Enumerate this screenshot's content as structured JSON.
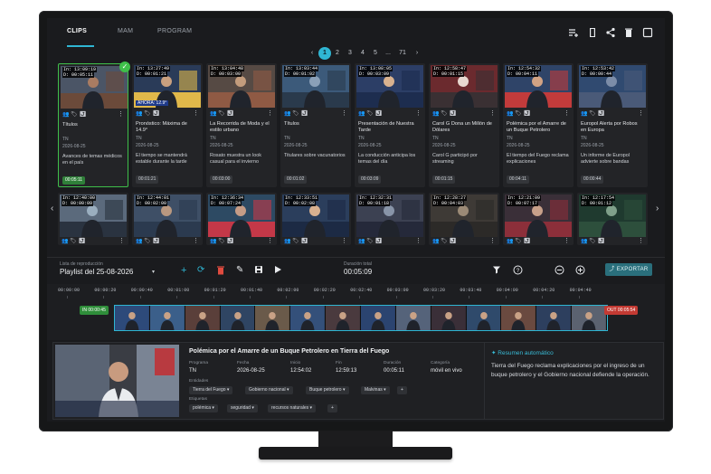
{
  "tabs": [
    {
      "label": "CLIPS",
      "active": true
    },
    {
      "label": "MAM",
      "active": false
    },
    {
      "label": "PROGRAM",
      "active": false
    }
  ],
  "top_icons": [
    "playlist-add-icon",
    "bookmark-icon",
    "share-icon",
    "delete-sweep-icon",
    "square-icon"
  ],
  "pagination": {
    "prev": "‹",
    "pages": [
      "1",
      "2",
      "3",
      "4",
      "5",
      "...",
      "71"
    ],
    "next": "›",
    "current": "1"
  },
  "clips_row1": [
    {
      "in": "In: 13:09:19",
      "dur": "D: 00:05:11",
      "title": "Títulos",
      "program": "TN",
      "date": "2026-08-25",
      "desc": "Avances de temas médicos en el país",
      "duration": "00:05:11",
      "selected": true
    },
    {
      "in": "In: 13:27:49",
      "dur": "D: 00:01:21",
      "title": "Pronóstico: Máxima de 14.9°",
      "program": "TN",
      "date": "2026-08-25",
      "desc": "El tiempo se mantendrá estable durante la tarde",
      "duration": "00:01:21",
      "overlay": "AHORA: 12.9°"
    },
    {
      "in": "In: 13:04:48",
      "dur": "D: 00:03:00",
      "title": "La Recorrida de Moda y el estilo urbano",
      "program": "TN",
      "date": "2026-08-25",
      "desc": "Rosato muestra un look casual para el invierno",
      "duration": "00:03:00"
    },
    {
      "in": "In: 13:03:44",
      "dur": "D: 00:01:02",
      "title": "Títulos",
      "program": "TN",
      "date": "2026-08-25",
      "desc": "Titulares sobre vacunatorios",
      "duration": "00:01:02"
    },
    {
      "in": "In: 13:08:05",
      "dur": "D: 00:03:09",
      "title": "Presentación de Nuestra Tarde",
      "program": "TN",
      "date": "2026-08-25",
      "desc": "La conducción anticipa los temas del día",
      "duration": "00:03:09"
    },
    {
      "in": "In: 12:58:47",
      "dur": "D: 00:01:15",
      "title": "Carol G Dona un Millón de Dólares",
      "program": "TN",
      "date": "2026-08-25",
      "desc": "Carol G participó por streaming",
      "duration": "00:01:15"
    },
    {
      "in": "In: 12:54:32",
      "dur": "D: 00:04:11",
      "title": "Polémica por el Amarre de un Buque Petrolero",
      "program": "TN",
      "date": "2026-08-25",
      "desc": "El tiempo del Fuego reclama explicaciones",
      "duration": "00:04:11"
    },
    {
      "in": "In: 12:53:42",
      "dur": "D: 00:00:44",
      "title": "Europol Alerta por Robos en Europa",
      "program": "TN",
      "date": "2026-08-25",
      "desc": "Un informe de Europol advierte sobre bandas",
      "duration": "00:00:44"
    }
  ],
  "clips_row2": [
    {
      "in": "In: 12:40:00",
      "dur": "D: 00:00:09"
    },
    {
      "in": "In: 12:44:01",
      "dur": "D: 00:02:00"
    },
    {
      "in": "In: 12:36:34",
      "dur": "D: 00:07:24"
    },
    {
      "in": "In: 12:33:51",
      "dur": "D: 00:02:08"
    },
    {
      "in": "In: 12:32:31",
      "dur": "D: 00:01:18"
    },
    {
      "in": "In: 12:28:27",
      "dur": "D: 00:04:03"
    },
    {
      "in": "In: 12:21:09",
      "dur": "D: 00:07:17"
    },
    {
      "in": "In: 12:17:54",
      "dur": "D: 00:01:12"
    }
  ],
  "toolbar": {
    "playlist_label": "Lista de reproducción",
    "playlist_value": "Playlist del 25-08-2026",
    "duration_label": "Duración total",
    "duration_value": "00:05:09",
    "export_label": "EXPORTAR"
  },
  "timeline": {
    "ticks": [
      "00:00:00",
      "00:00:20",
      "00:00:40",
      "00:01:00",
      "00:01:20",
      "00:01:40",
      "00:02:00",
      "00:02:20",
      "00:02:40",
      "00:03:00",
      "00:03:20",
      "00:03:40",
      "00:04:00",
      "00:04:20",
      "00:04:40"
    ],
    "in_label": "IN 00:00:45",
    "out_label": "OUT 00:05:54"
  },
  "detail": {
    "title": "Polémica por el Amarre de un Buque Petrolero en Tierra del Fuego",
    "fields": [
      {
        "label": "Programa",
        "value": "TN"
      },
      {
        "label": "Fecha",
        "value": "2026-08-25"
      },
      {
        "label": "Inicio",
        "value": "12:54:02"
      },
      {
        "label": "Fin",
        "value": "12:59:13"
      },
      {
        "label": "Duración",
        "value": "00:05:11"
      },
      {
        "label": "Categoría",
        "value": "móvil en vivo"
      }
    ],
    "entities_label": "Entidades",
    "entities": [
      "Tierra del Fuego",
      "Gobierno nacional",
      "Buque petrolero",
      "Malvinas"
    ],
    "tags_label": "Etiquetas",
    "tags": [
      "polémica",
      "seguridad",
      "recursos naturales"
    ],
    "add": "+",
    "summary_title": "Resumen automático",
    "summary_text": "Tierra del Fuego reclama explicaciones por el ingreso de un buque petrolero y el Gobierno nacional defiende la operación."
  },
  "colors": {
    "accent": "#2fb6d3",
    "selected": "#3fbf4a",
    "delete": "#e04b3f",
    "out": "#c33a33"
  }
}
